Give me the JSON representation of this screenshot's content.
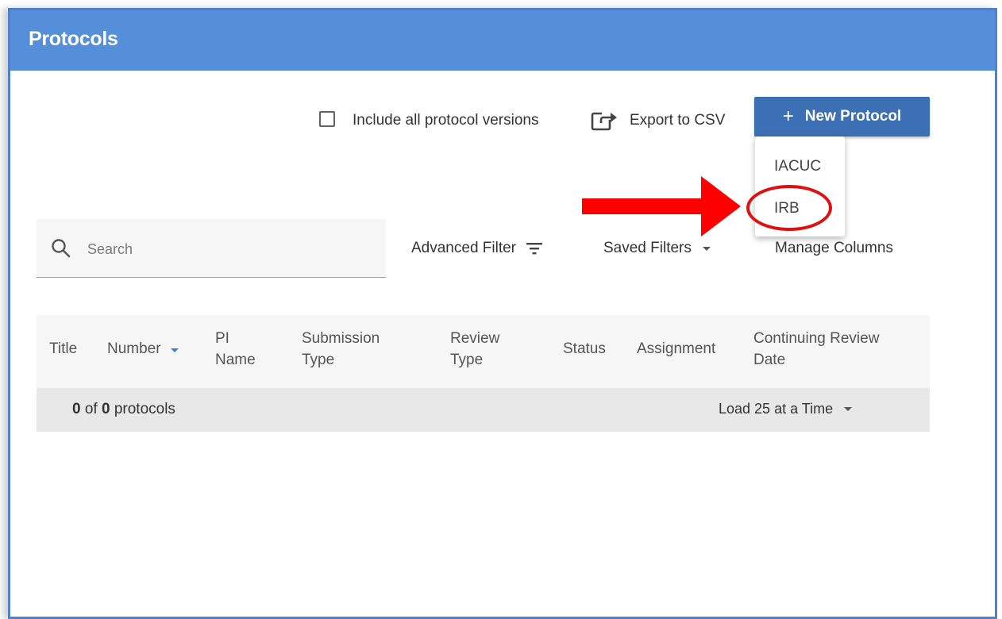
{
  "header": {
    "title": "Protocols"
  },
  "toolbar": {
    "include_versions_label": "Include all protocol versions",
    "export_label": "Export to CSV",
    "new_protocol_label": "New Protocol"
  },
  "new_protocol_menu": {
    "items": [
      "IACUC",
      "IRB"
    ]
  },
  "search": {
    "placeholder": "Search"
  },
  "filters": {
    "advanced_filter_label": "Advanced Filter",
    "saved_filters_label": "Saved Filters",
    "manage_columns_label": "Manage Columns"
  },
  "table": {
    "columns": [
      {
        "line1": "Title",
        "line2": ""
      },
      {
        "line1": "Number",
        "line2": ""
      },
      {
        "line1": "PI",
        "line2": "Name"
      },
      {
        "line1": "Submission",
        "line2": "Type"
      },
      {
        "line1": "Review",
        "line2": "Type"
      },
      {
        "line1": "Status",
        "line2": ""
      },
      {
        "line1": "Assignment",
        "line2": ""
      },
      {
        "line1": "Continuing Review",
        "line2": "Date"
      }
    ],
    "footer": {
      "shown": "0",
      "of_text": " of ",
      "total": "0",
      "unit": " protocols",
      "load_label": "Load 25 at a Time"
    }
  },
  "colors": {
    "header_bg": "#558ed9",
    "primary_button": "#3d6fb4",
    "annotation_red": "#e01010",
    "sort_indicator": "#3d7bd9"
  },
  "icons": [
    "export-icon",
    "plus-icon",
    "search-icon",
    "filter-icon",
    "chevron-down-icon",
    "sort-desc-icon"
  ]
}
